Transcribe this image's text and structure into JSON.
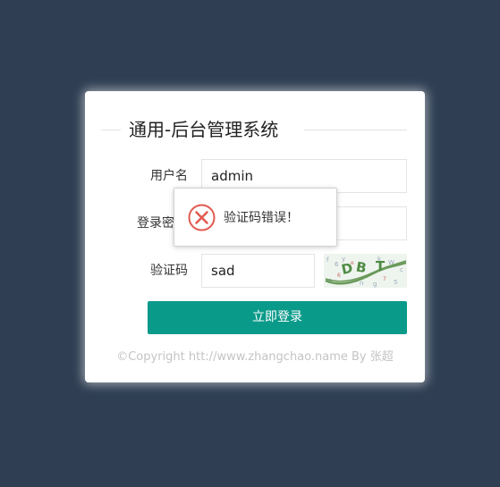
{
  "login": {
    "title": "通用-后台管理系统",
    "username_label": "用户名",
    "username_value": "admin",
    "password_label": "登录密码",
    "captcha_label": "验证码",
    "captcha_value": "sad",
    "submit_label": "立即登录",
    "copyright": "©Copyright htt://www.zhangchao.name By 张超"
  },
  "toast": {
    "message": "验证码错误！",
    "icon": "error-circle-icon",
    "icon_color": "#e05a4f"
  },
  "colors": {
    "background": "#2f3e53",
    "primary_button": "#0a9a8a"
  }
}
